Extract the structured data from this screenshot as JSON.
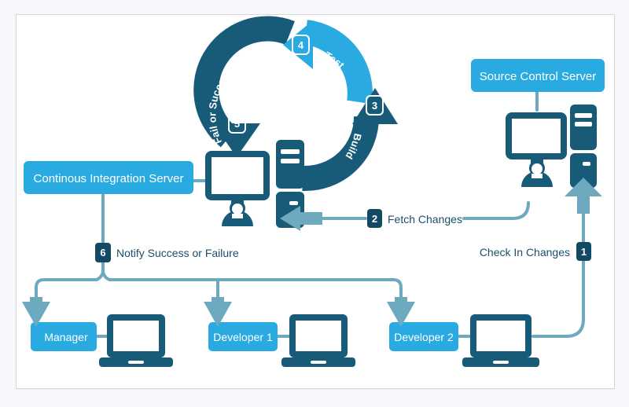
{
  "diagram": {
    "title_visible": false,
    "colors": {
      "page_background": "#f7f8fc",
      "panel_background": "#ffffff",
      "panel_border": "#d8d8dc",
      "cyan": "#29abe2",
      "dark_navy": "#175b78",
      "darker_navy": "#144d66",
      "steel_blue": "#6da9bf",
      "label_text": "#1b4f6b",
      "badge_fill": "#134a63",
      "badge_text": "#ffffff"
    },
    "boxes": {
      "ci_server": {
        "label": "Continous Integration Server",
        "color": "#29abe2"
      },
      "source_control_server": {
        "label": "Source Control Server",
        "color": "#29abe2"
      },
      "manager": {
        "label": "Manager",
        "color": "#29abe2"
      },
      "developer_1": {
        "label": "Developer 1",
        "color": "#29abe2"
      },
      "developer_2": {
        "label": "Developer 2",
        "color": "#29abe2"
      }
    },
    "steps": [
      {
        "number": "1",
        "label": "Check In Changes",
        "badge_style": "filled",
        "badge_color": "#134a63"
      },
      {
        "number": "2",
        "label": "Fetch Changes",
        "badge_style": "filled",
        "badge_color": "#134a63"
      },
      {
        "number": "3",
        "label": "Build",
        "badge_style": "outline",
        "arrow_color": "#175b78"
      },
      {
        "number": "4",
        "label": "Test",
        "badge_style": "outline",
        "arrow_color": "#29abe2"
      },
      {
        "number": "5",
        "label": "Fail or Succeed",
        "badge_style": "outline",
        "arrow_color": "#175b78"
      },
      {
        "number": "6",
        "label": "Notify Success or Failure",
        "badge_style": "filled",
        "badge_color": "#134a63"
      }
    ],
    "cycle": {
      "arcs": [
        {
          "name": "test",
          "label": "Test",
          "color": "#29abe2"
        },
        {
          "name": "build",
          "label": "Build",
          "color": "#175b78"
        },
        {
          "name": "fail-or-succeed",
          "label": "Fail or Succeed",
          "color": "#175b78"
        }
      ]
    },
    "icons": {
      "desktop_ci": "desktop-computer-icon",
      "tower_ci": "server-tower-icon",
      "desktop_scm": "desktop-computer-icon",
      "tower_scm": "server-tower-icon",
      "laptop_manager": "laptop-icon",
      "laptop_dev1": "laptop-icon",
      "laptop_dev2": "laptop-icon",
      "user_ci": "user-avatar-icon",
      "user_scm": "user-avatar-icon"
    }
  }
}
